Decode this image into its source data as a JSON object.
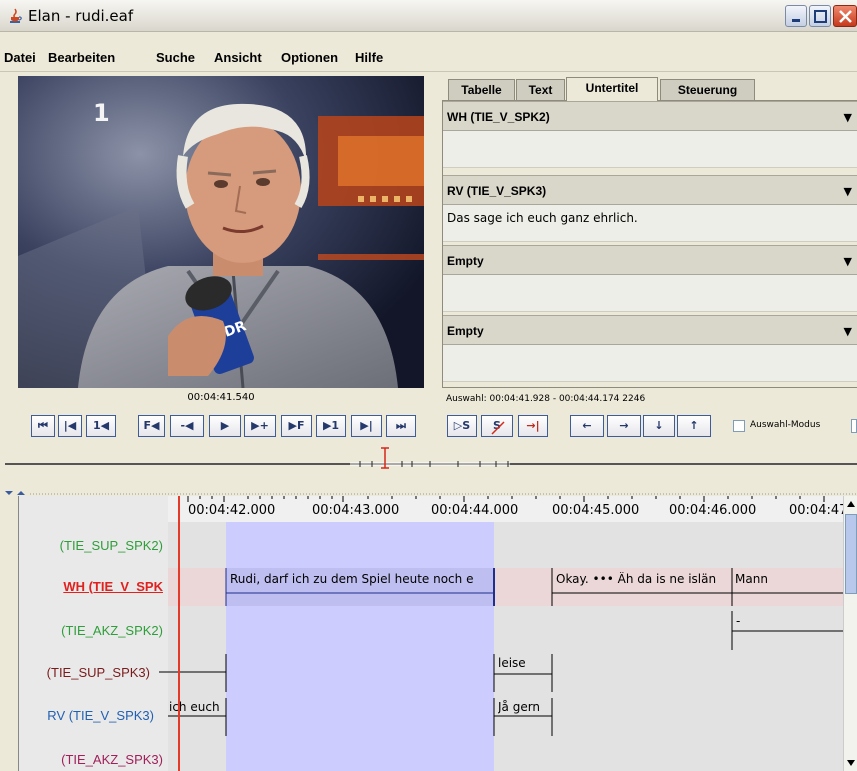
{
  "window": {
    "title": "Elan - rudi.eaf"
  },
  "menu": [
    {
      "label": "Datei"
    },
    {
      "label": "Bearbeiten"
    },
    {
      "label": "Suche"
    },
    {
      "label": "Ansicht"
    },
    {
      "label": "Optionen"
    },
    {
      "label": "Hilfe"
    }
  ],
  "video": {
    "logo": "1",
    "mic_label": "WDR",
    "timecode": "00:04:41.540"
  },
  "tabs": [
    {
      "label": "Tabelle"
    },
    {
      "label": "Text"
    },
    {
      "label": "Untertitel",
      "active": true
    },
    {
      "label": "Steuerung"
    }
  ],
  "subtitle_tiers": [
    {
      "name": "WH (TIE_V_SPK2)",
      "text": ""
    },
    {
      "name": "RV (TIE_V_SPK3)",
      "text": "Das sage ich euch ganz ehrlich."
    },
    {
      "name": "Empty",
      "text": ""
    },
    {
      "name": "Empty",
      "text": ""
    }
  ],
  "selection": {
    "text": "Auswahl: 00:04:41.928 - 00:04:44.174  2246"
  },
  "player_controls": [
    {
      "icon": "go-to-begin-icon",
      "label": "⏮"
    },
    {
      "icon": "previous-frame-icon",
      "label": "|◀"
    },
    {
      "icon": "previous-second-icon",
      "label": "1◀"
    },
    {
      "icon": "frame-back-icon",
      "label": "F◀"
    },
    {
      "icon": "step-back-icon",
      "label": "-◀"
    },
    {
      "icon": "play-icon",
      "label": "▶"
    },
    {
      "icon": "step-forward-icon",
      "label": "▶+"
    },
    {
      "icon": "frame-forward-icon",
      "label": "▶F"
    },
    {
      "icon": "next-second-icon",
      "label": "▶1"
    },
    {
      "icon": "next-frame-icon",
      "label": "▶|"
    },
    {
      "icon": "go-to-end-icon",
      "label": "⏭"
    }
  ],
  "selection_controls": [
    {
      "icon": "play-selection-icon",
      "label": "▷S"
    },
    {
      "icon": "clear-selection-icon",
      "label": "S"
    },
    {
      "icon": "go-to-selection-icon",
      "label": "→|"
    }
  ],
  "navigation_controls": [
    {
      "icon": "arrow-left-icon",
      "label": "←"
    },
    {
      "icon": "arrow-right-icon",
      "label": "→"
    },
    {
      "icon": "arrow-down-icon",
      "label": "↓"
    },
    {
      "icon": "arrow-up-icon",
      "label": "↑"
    }
  ],
  "selection_mode": {
    "label": "Auswahl-Modus",
    "checked": false
  },
  "timeline": {
    "ticks": [
      "00:04:42.000",
      "00:04:43.000",
      "00:04:44.000",
      "00:04:45.000",
      "00:04:46.000",
      "00:04:47"
    ],
    "tiers": [
      {
        "label": "(TIE_SUP_SPK2)",
        "color": "#2e9e3a"
      },
      {
        "label": "WH (TIE_V_SPK",
        "color": "#e0211e",
        "active": true
      },
      {
        "label": "(TIE_AKZ_SPK2)",
        "color": "#2e9e3a"
      },
      {
        "label": "(TIE_SUP_SPK3)",
        "color": "#7a1b1b"
      },
      {
        "label": "RV (TIE_V_SPK3)",
        "color": "#2160b3"
      },
      {
        "label": "(TIE_AKZ_SPK3)",
        "color": "#a0205a"
      }
    ],
    "annotations": {
      "wh_1": "Rudi, darf ich zu dem Spiel heute noch e",
      "wh_2": "Okay. ••• Äh da is ne islän",
      "wh_3": "Mann",
      "akz2_1": "-",
      "sup3_1": "leise",
      "rv_1": "ich euch",
      "rv_2": "Jå gern"
    }
  }
}
